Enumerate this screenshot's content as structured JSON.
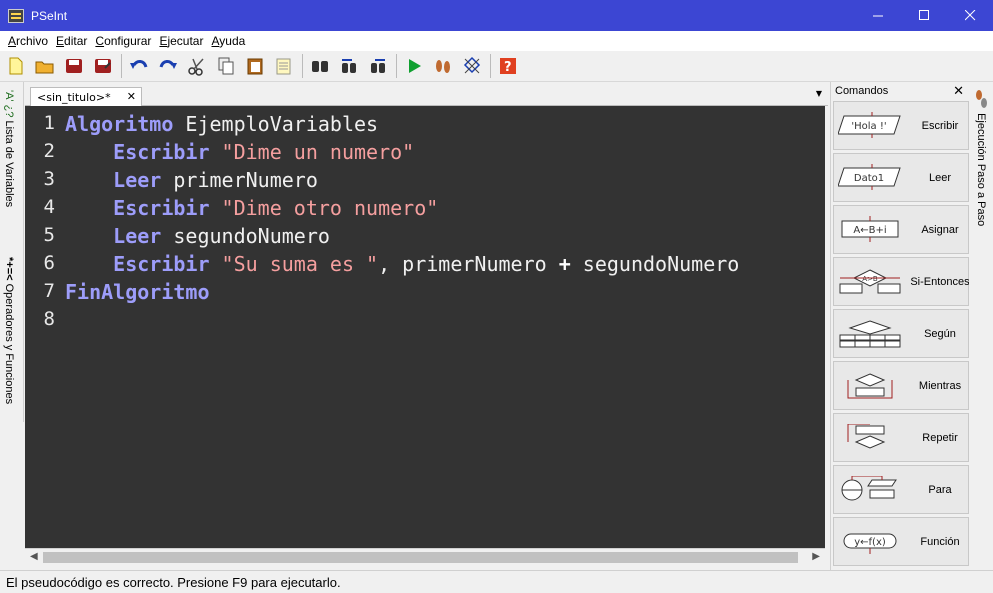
{
  "window": {
    "title": "PSeInt"
  },
  "menu": [
    {
      "label": "Archivo",
      "ul": "A",
      "rest": "rchivo"
    },
    {
      "label": "Editar",
      "ul": "E",
      "rest": "ditar"
    },
    {
      "label": "Configurar",
      "ul": "C",
      "rest": "onfigurar"
    },
    {
      "label": "Ejecutar",
      "ul": "E",
      "rest": "jecutar"
    },
    {
      "label": "Ayuda",
      "ul": "A",
      "rest": "yuda"
    }
  ],
  "toolbar_icons": [
    "new-file-icon",
    "open-folder-icon",
    "save-icon",
    "save-as-icon",
    "undo-icon",
    "redo-icon",
    "cut-icon",
    "copy-icon",
    "paste-icon",
    "edit-icon",
    "find-icon",
    "find-previous-icon",
    "find-next-icon",
    "run-icon",
    "step-by-step-icon",
    "flowchart-icon",
    "help-icon"
  ],
  "left_dock": {
    "variables_tab": "Lista de Variables",
    "variables_glyph": "*+=<",
    "operators_tab": "Operadores y Funciones",
    "operators_glyph": "'A' ¿?"
  },
  "tabs": [
    {
      "label": "<sin_titulo>*"
    }
  ],
  "editor": {
    "lines": [
      {
        "n": "1",
        "tokens": [
          {
            "t": "Algoritmo",
            "c": "kw"
          },
          {
            "t": " EjemploVariables",
            "c": "code"
          }
        ]
      },
      {
        "n": "2",
        "tokens": [
          {
            "t": "    Escribir",
            "c": "kw"
          },
          {
            "t": " ",
            "c": "code"
          },
          {
            "t": "\"Dime un numero\"",
            "c": "str"
          }
        ]
      },
      {
        "n": "3",
        "tokens": [
          {
            "t": "    Leer",
            "c": "kw"
          },
          {
            "t": " primerNumero",
            "c": "code"
          }
        ]
      },
      {
        "n": "4",
        "tokens": [
          {
            "t": "    Escribir",
            "c": "kw"
          },
          {
            "t": " ",
            "c": "code"
          },
          {
            "t": "\"Dime otro numero\"",
            "c": "str"
          }
        ]
      },
      {
        "n": "5",
        "tokens": [
          {
            "t": "    Leer",
            "c": "kw"
          },
          {
            "t": " segundoNumero",
            "c": "code"
          }
        ]
      },
      {
        "n": "6",
        "tokens": [
          {
            "t": "    Escribir",
            "c": "kw"
          },
          {
            "t": " ",
            "c": "code"
          },
          {
            "t": "\"Su suma es \"",
            "c": "str"
          },
          {
            "t": ", primerNumero ",
            "c": "code"
          },
          {
            "t": "+",
            "c": "op"
          },
          {
            "t": " segundoNumero",
            "c": "code"
          }
        ]
      },
      {
        "n": "7",
        "tokens": [
          {
            "t": "FinAlgoritmo",
            "c": "kw"
          }
        ]
      },
      {
        "n": "8",
        "tokens": []
      }
    ]
  },
  "commands": {
    "title": "Comandos",
    "items": [
      {
        "label": "Escribir",
        "icon": "escribir-icon",
        "glyph": "'Hola !'"
      },
      {
        "label": "Leer",
        "icon": "leer-icon",
        "glyph": "Dato1"
      },
      {
        "label": "Asignar",
        "icon": "asignar-icon",
        "glyph": "A←B+i"
      },
      {
        "label": "Si-Entonces",
        "icon": "si-entonces-icon",
        "glyph": "A>B"
      },
      {
        "label": "Según",
        "icon": "segun-icon",
        "glyph": ""
      },
      {
        "label": "Mientras",
        "icon": "mientras-icon",
        "glyph": ""
      },
      {
        "label": "Repetir",
        "icon": "repetir-icon",
        "glyph": ""
      },
      {
        "label": "Para",
        "icon": "para-icon",
        "glyph": ""
      },
      {
        "label": "Función",
        "icon": "funcion-icon",
        "glyph": "y←f(x)"
      }
    ]
  },
  "right_dock": {
    "step_tab": "Ejecución Paso a Paso"
  },
  "status": {
    "text": "El pseudocódigo es correcto. Presione F9 para ejecutarlo."
  },
  "colors": {
    "titlebar": "#3c46d3",
    "editor_bg": "#333333",
    "keyword": "#9d9dfa",
    "string": "#f59f9f"
  }
}
